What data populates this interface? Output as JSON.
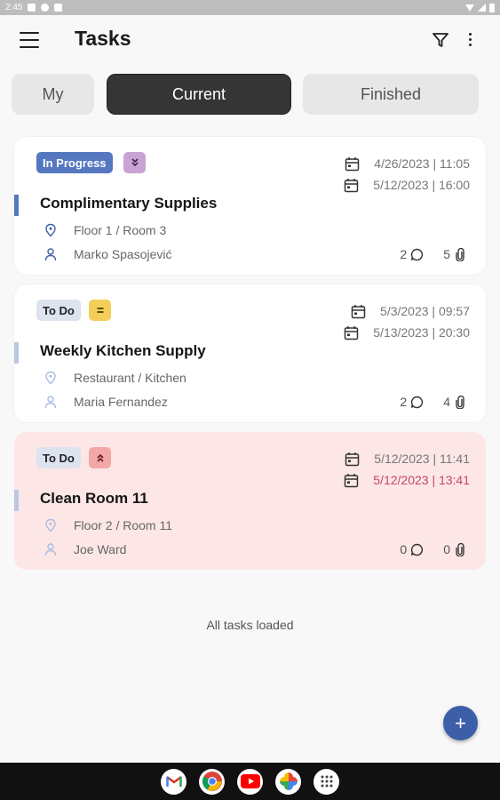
{
  "status_bar": {
    "time": "2:45"
  },
  "header": {
    "title": "Tasks"
  },
  "tabs": [
    {
      "label": "My",
      "selected": false
    },
    {
      "label": "Current",
      "selected": true
    },
    {
      "label": "Finished",
      "selected": false
    }
  ],
  "tasks": [
    {
      "status": "In Progress",
      "priority_icon": "chevrons-down-icon",
      "title": "Complimentary Supplies",
      "location": "Floor 1 / Room 3",
      "assignee": "Marko  Spasojević",
      "start": "4/26/2023  |  11:05",
      "due": "5/12/2023  |  16:00",
      "comments": "2",
      "attachments": "5"
    },
    {
      "status": "To Do",
      "priority_icon": "equals-icon",
      "title": "Weekly Kitchen Supply",
      "location": "Restaurant / Kitchen",
      "assignee": "Maria Fernandez",
      "start": "5/3/2023  |  09:57",
      "due": "5/13/2023  |  20:30",
      "comments": "2",
      "attachments": "4"
    },
    {
      "status": "To Do",
      "priority_icon": "chevrons-up-icon",
      "title": "Clean Room 11",
      "location": "Floor 2 / Room 11",
      "assignee": "Joe  Ward",
      "start": "5/12/2023  |  11:41",
      "due": "5/12/2023  |  13:41",
      "comments": "0",
      "attachments": "0"
    }
  ],
  "footer_text": "All tasks loaded",
  "fab_label": "+",
  "colors": {
    "accent_blue": "#3d5fa8",
    "in_progress_badge": "#5577c0",
    "todo_badge": "#dde3ef",
    "priority_low": "#c9a3d6",
    "priority_medium": "#f3cf5a",
    "priority_high": "#f5a6a6",
    "overdue_card": "#fde6e6",
    "overdue_text": "#c2466a"
  }
}
